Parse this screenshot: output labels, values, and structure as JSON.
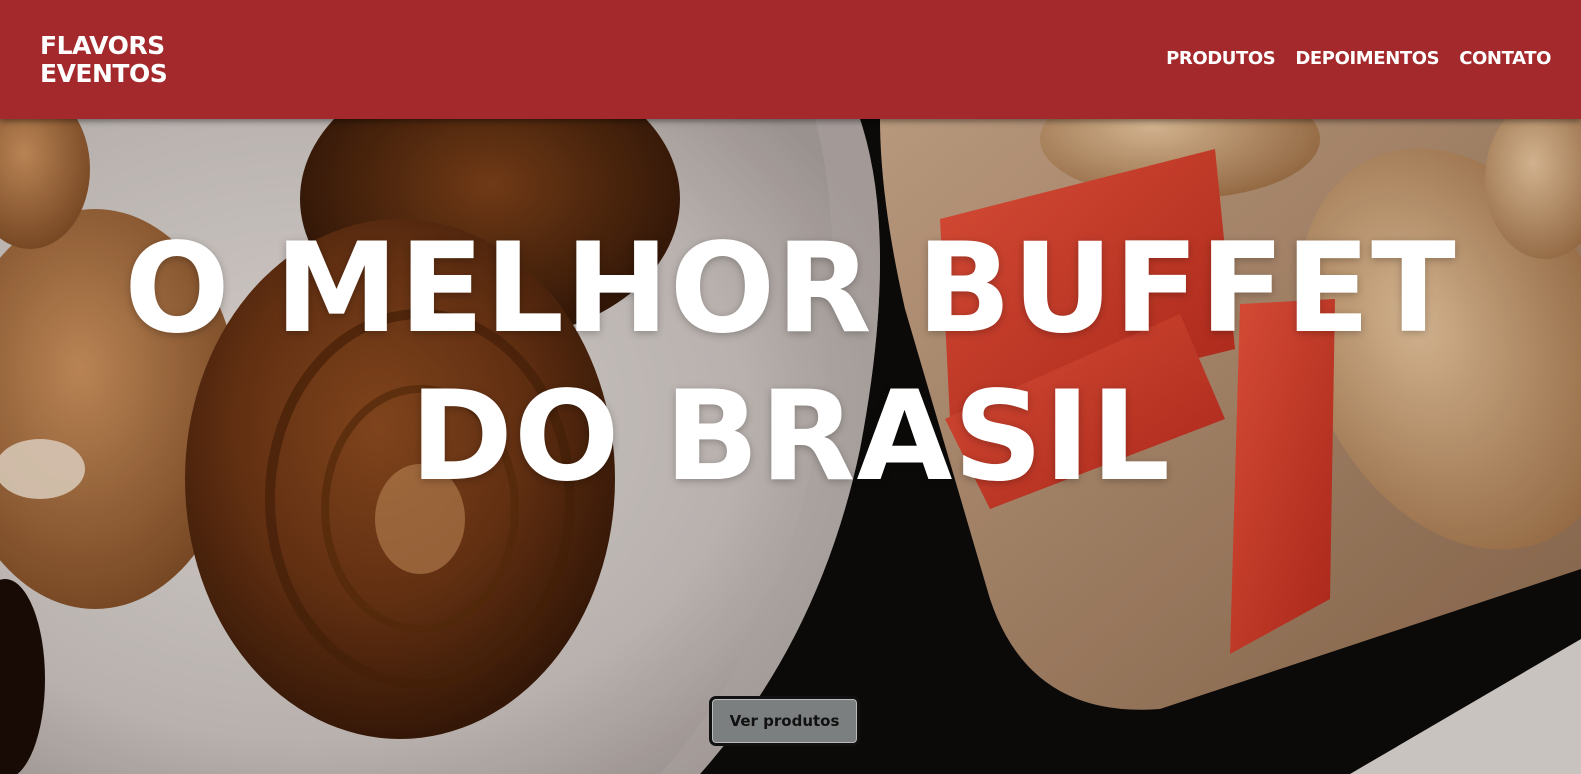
{
  "header": {
    "logo_line1": "FLAVORS",
    "logo_line2": "EVENTOS",
    "nav": [
      {
        "label": "PRODUTOS"
      },
      {
        "label": "DEPOIMENTOS"
      },
      {
        "label": "CONTATO"
      }
    ]
  },
  "hero": {
    "title_line1": "O MELHOR BUFFET",
    "title_line2": "DO BRASIL",
    "cta_label": "Ver produtos"
  },
  "colors": {
    "header_bg": "#a4292c",
    "text": "#ffffff",
    "button_bg": "#7c7f7f"
  }
}
